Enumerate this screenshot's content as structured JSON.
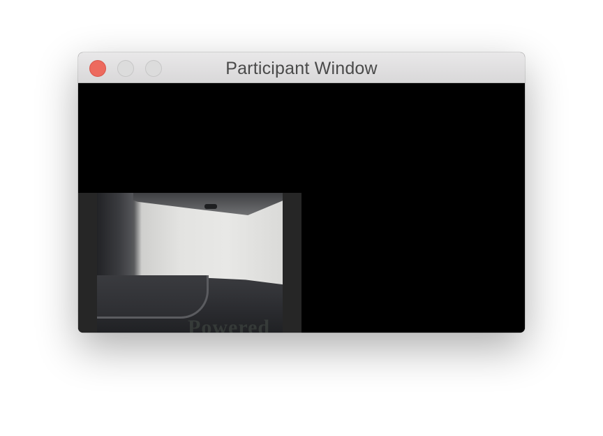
{
  "window": {
    "title": "Participant Window",
    "controls": {
      "close_color": "#ed6a5e",
      "inactive_color": "#dcdcdc"
    }
  },
  "video": {
    "background_color": "#000000",
    "tile_background_color": "#262626"
  }
}
